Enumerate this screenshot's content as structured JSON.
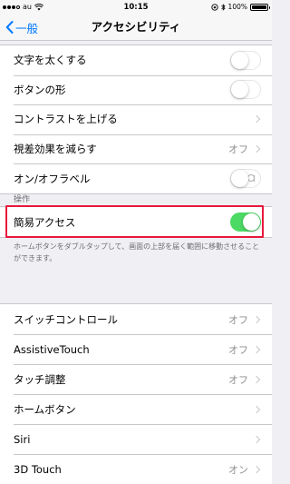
{
  "status_bar": {
    "carrier": "au",
    "time": "10:15",
    "battery_percent": "100%",
    "battery_level": 1.0,
    "signal_bars_filled": 3,
    "signal_bars_total": 4
  },
  "nav": {
    "back_label": "一般",
    "title": "アクセシビリティ"
  },
  "group1": [
    {
      "label": "文字を太くする",
      "type": "toggle",
      "on": false
    },
    {
      "label": "ボタンの形",
      "type": "toggle",
      "on": false
    },
    {
      "label": "コントラストを上げる",
      "type": "chevron"
    },
    {
      "label": "視差効果を減らす",
      "type": "chevron",
      "value": "オフ"
    },
    {
      "label": "オン/オフラベル",
      "type": "toggle",
      "on": false
    }
  ],
  "section_header": "操作",
  "reachability": {
    "label": "簡易アクセス",
    "on": true
  },
  "reachability_footer": "ホームボタンをダブルタップして、画面の上部を届く範囲に移動させることができます。",
  "group3": [
    {
      "label": "スイッチコントロール",
      "value": "オフ"
    },
    {
      "label": "AssistiveTouch",
      "value": "オフ"
    },
    {
      "label": "タッチ調整",
      "value": "オフ"
    },
    {
      "label": "ホームボタン",
      "value": ""
    },
    {
      "label": "Siri",
      "value": ""
    },
    {
      "label": "3D Touch",
      "value": "オン"
    }
  ],
  "colors": {
    "accent": "#007aff",
    "toggle_on": "#4cd964",
    "highlight": "#e8173c"
  }
}
